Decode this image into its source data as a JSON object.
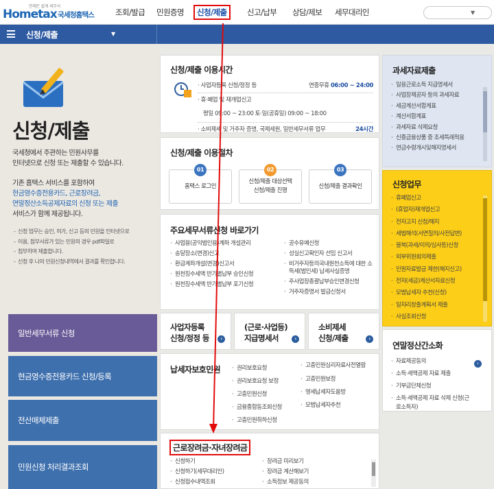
{
  "header": {
    "logo_tag": "언제든 쉽게 세무서",
    "logo_word": "Hometax",
    "logo_kor": "국세청홈택스",
    "nav": [
      "조회/발급",
      "민원증명",
      "신청/제출",
      "신고/납부",
      "상담/제보",
      "세무대리인"
    ],
    "search_placeholder": ""
  },
  "subbar": {
    "title": "신청/제출"
  },
  "hero": {
    "title": "신청/제출",
    "desc1": "국세청에서 주관하는 민원사무를",
    "desc2": "인터넷으로 신청 또는 제출할 수 있습니다.",
    "p2_line1": "기존 홈택스 서비스를 포함하여",
    "p2_line2": "현금영수증전용카드, 근로장려금,",
    "p2_line3a": "연말정산소득공제자료의 신청 또는 제출",
    "p2_line4": "서비스가 함께 제공됩니다.",
    "notes": [
      "신청 업무는 승인, 허가, 신고 등의 민원을 인터넷으로",
      "이용, 첨부서류가 있는 민원의 경우 pdf파일로",
      "첨부하여 제출합니다.",
      "신청 후 나의 민원신청내역에서 결과를 확인합니다."
    ]
  },
  "left_buttons": [
    "일반세무서류 신청",
    "현금영수증전용카드 신청/등록",
    "전산매체제출",
    "민원신청 처리결과조회"
  ],
  "usage_time": {
    "title": "신청/제출 이용시간",
    "rows": [
      {
        "label": "· 사업자등록 신청/정정 등",
        "value_pre": "연중무휴 ",
        "value_b": "06:00 ~ 24:00"
      },
      {
        "label": "· 휴·폐업 및 재개업신고",
        "value_pre": "",
        "value_b": ""
      },
      {
        "label": "평일 09:00 ~ 23:00 토·일(공휴일) 09:00 ~ 18:00",
        "value_pre": "",
        "value_b": ""
      },
      {
        "label": "· 소비제세 및 거주자 증명, 국제세원, 일반세무서류 업무",
        "value_pre": "",
        "value_b": "24시간"
      }
    ]
  },
  "procedure": {
    "title": "신청/제출 이용절차",
    "steps": [
      {
        "num": "01",
        "line1": "홈택스 로그인",
        "line2": ""
      },
      {
        "num": "02",
        "line1": "신청/제출 대상선택",
        "line2": "신청/제출 진행"
      },
      {
        "num": "03",
        "line1": "신청/제출 결과확인",
        "line2": ""
      }
    ]
  },
  "shortcuts": {
    "title": "주요세무서류신청 바로가기",
    "left": [
      "사업용(공익법인용)계좌 개설관리",
      "송달장소(변경)신고",
      "환급계좌개설(변경)신고서",
      "원천징수세액 반기별납부 승인신청",
      "원천징수세액 반기별납부 포기신청"
    ],
    "right": [
      "공수유예신청",
      "성실신고확인자 선임 신고서",
      "비거주자등의국내원천소득에 대한 소득세(법인세) 납세사실증명",
      "주사업장총괄납부승인변경신청",
      "거주자증명서 발급신청서"
    ]
  },
  "tiles": [
    {
      "l1": "사업자등록",
      "l2": "신청/정정 등"
    },
    {
      "l1": "(근로·사업등)",
      "l2": "지급명세서"
    },
    {
      "l1": "소비제세",
      "l2": "신청/제출"
    }
  ],
  "taxpayer": {
    "title": "납세자보호민원",
    "left": [
      "권리보호요청",
      "권리보호요청 보정",
      "고충민원신청",
      "금융종합동조회신청",
      "고충민원취하신청"
    ],
    "right": [
      "고충민원심리자료사전열람",
      "고충민원보정",
      "영세납세자도움방",
      "모범납세자추천"
    ]
  },
  "eitc": {
    "title": "근로장려금·자녀장려금",
    "left": [
      "신청하기",
      "신청하기(세무대리인)",
      "신청접수내역조회"
    ],
    "right": [
      "장려금 미리보기",
      "장려금 계산해보기",
      "소득정보 제공동의"
    ]
  },
  "tax_data": {
    "title": "과세자료제출",
    "items": [
      "일용근로소득 지급명세서",
      "사업장제공자 등의 과세자료",
      "세금계산서합계표",
      "계산서합계표",
      "과세자료 삭제요청",
      "신종금융상품 중 조세특례적용",
      "연금수령개시및해지명세서"
    ]
  },
  "apply_work": {
    "title": "신청업무",
    "items": [
      "휴폐업신고",
      "(휴업자)재개업신고",
      "전자고지 신청/해지",
      "세법해석(서면질의/사전답변)",
      "불복(과세/이의/심사등)신청",
      "외부위원회의제출",
      "민원자료발급 제한(해지신고)",
      "전자(세금)계산서자료신청",
      "모범납세자 추천(신청)",
      "일자리창출계획서 제출",
      "사실조회신청"
    ]
  },
  "yearend": {
    "title": "연말정산간소화",
    "items": [
      "자료제공동의",
      "소득·세액공제 자료 제출",
      "기부금단체신청",
      "소득·세액공제 자료 삭제 신청(근로소득자)"
    ]
  },
  "colors": {
    "accent": "#2d5aa1",
    "highlight": "#e20a0a",
    "yellow": "#fcce17",
    "purple": "#685b97"
  }
}
